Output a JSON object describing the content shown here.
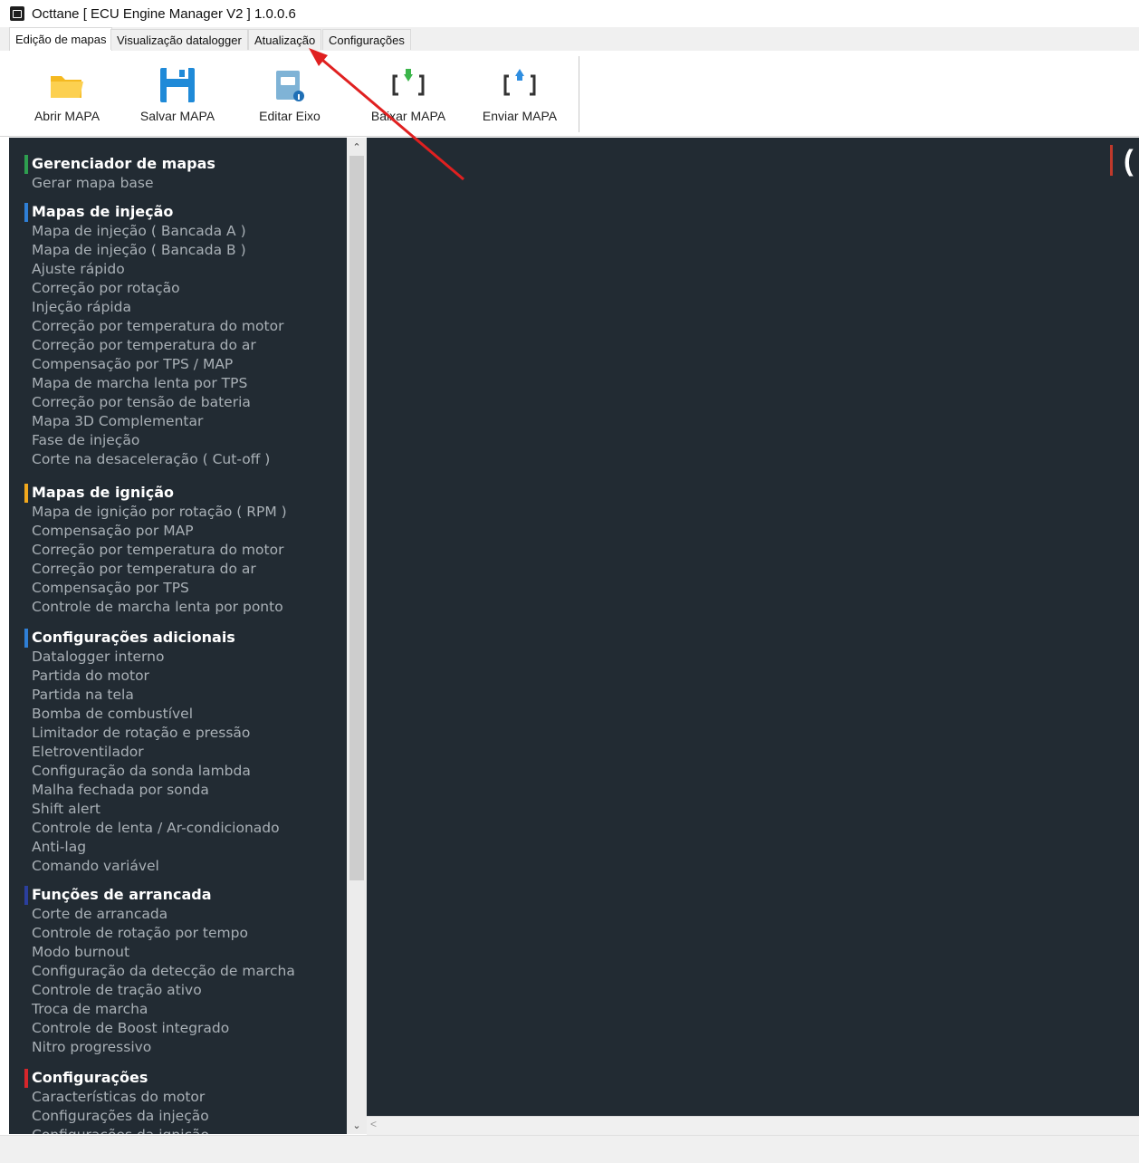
{
  "window": {
    "title": "Octtane [ ECU Engine Manager V2 ] 1.0.0.6"
  },
  "tabs": [
    {
      "label": "Edição de mapas"
    },
    {
      "label": "Visualização datalogger"
    },
    {
      "label": "Atualização"
    },
    {
      "label": "Configurações"
    }
  ],
  "toolbar": {
    "abrir": "Abrir MAPA",
    "salvar": "Salvar MAPA",
    "editar": "Editar Eixo",
    "baixar": "Baixar MAPA",
    "enviar": "Enviar MAPA"
  },
  "sidebar": {
    "sections": [
      {
        "title": "Gerenciador de mapas",
        "color": "#2e9e4f",
        "items": [
          "Gerar mapa base"
        ]
      },
      {
        "title": "Mapas de injeção",
        "color": "#2f7fd6",
        "items": [
          "Mapa de injeção ( Bancada A )",
          "Mapa de injeção ( Bancada B )",
          "Ajuste rápido",
          "Correção por rotação",
          "Injeção rápida",
          "Correção por temperatura do motor",
          "Correção por temperatura do ar",
          "Compensação por TPS / MAP",
          "Mapa de marcha lenta por TPS",
          "Correção por tensão de bateria",
          "Mapa 3D Complementar",
          "Fase de injeção",
          "Corte na desaceleração ( Cut-off )"
        ]
      },
      {
        "title": "Mapas de ignição",
        "color": "#f2a81d",
        "items": [
          "Mapa de ignição por rotação ( RPM )",
          "Compensação por MAP",
          "Correção por temperatura do motor",
          "Correção por temperatura do ar",
          "Compensação por TPS",
          "Controle de marcha lenta por ponto"
        ]
      },
      {
        "title": "Configurações adicionais",
        "color": "#2f7fd6",
        "items": [
          "Datalogger interno",
          "Partida do motor",
          "Partida na tela",
          "Bomba de combustível",
          "Limitador de rotação e pressão",
          "Eletroventilador",
          "Configuração da sonda lambda",
          "Malha fechada por sonda",
          "Shift alert",
          "Controle de lenta / Ar-condicionado",
          "Anti-lag",
          "Comando variável"
        ]
      },
      {
        "title": "Funções de arrancada",
        "color": "#2b3f9e",
        "items": [
          "Corte de arrancada",
          "Controle de rotação por tempo",
          "Modo burnout",
          "Configuração da detecção de marcha",
          "Controle de tração ativo",
          "Troca de marcha",
          "Controle de Boost integrado",
          "Nitro progressivo"
        ]
      },
      {
        "title": "Configurações",
        "color": "#d6262b",
        "items": [
          "Características do motor",
          "Configurações da injeção",
          "Configurações da ignição"
        ]
      }
    ]
  },
  "main": {
    "edge_char": "("
  }
}
